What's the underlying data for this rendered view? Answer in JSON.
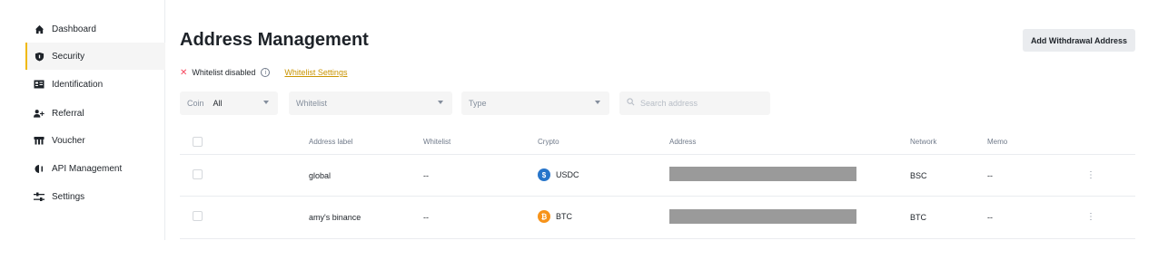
{
  "sidebar": {
    "items": [
      {
        "label": "Dashboard",
        "icon": "home-icon"
      },
      {
        "label": "Security",
        "icon": "shield-icon",
        "active": true
      },
      {
        "label": "Identification",
        "icon": "id-card-icon"
      },
      {
        "label": "Referral",
        "icon": "add-user-icon"
      },
      {
        "label": "Voucher",
        "icon": "voucher-icon"
      },
      {
        "label": "API Management",
        "icon": "api-icon"
      },
      {
        "label": "Settings",
        "icon": "sliders-icon"
      }
    ]
  },
  "header": {
    "title": "Address Management",
    "add_button": "Add Withdrawal Address"
  },
  "whitelist": {
    "status_icon": "x-icon",
    "status": "Whitelist disabled",
    "info_glyph": "i",
    "link": "Whitelist Settings"
  },
  "filters": {
    "coin_label": "Coin",
    "coin_value": "All",
    "whitelist_label": "Whitelist",
    "type_label": "Type",
    "search_placeholder": "Search address"
  },
  "table": {
    "columns": [
      "Address label",
      "Whitelist",
      "Crypto",
      "Address",
      "Network",
      "Memo"
    ],
    "rows": [
      {
        "label": "global",
        "whitelist": "--",
        "crypto": "USDC",
        "crypto_glyph": "$",
        "network": "BSC",
        "memo": "--"
      },
      {
        "label": "amy's binance",
        "whitelist": "--",
        "crypto": "BTC",
        "crypto_glyph": "₿",
        "network": "BTC",
        "memo": "--"
      }
    ],
    "more_glyph": "⋮"
  },
  "colors": {
    "accent": "#f0b90b",
    "link": "#c99400",
    "error": "#f6465d",
    "usdc": "#2775ca",
    "btc": "#f7931a"
  }
}
